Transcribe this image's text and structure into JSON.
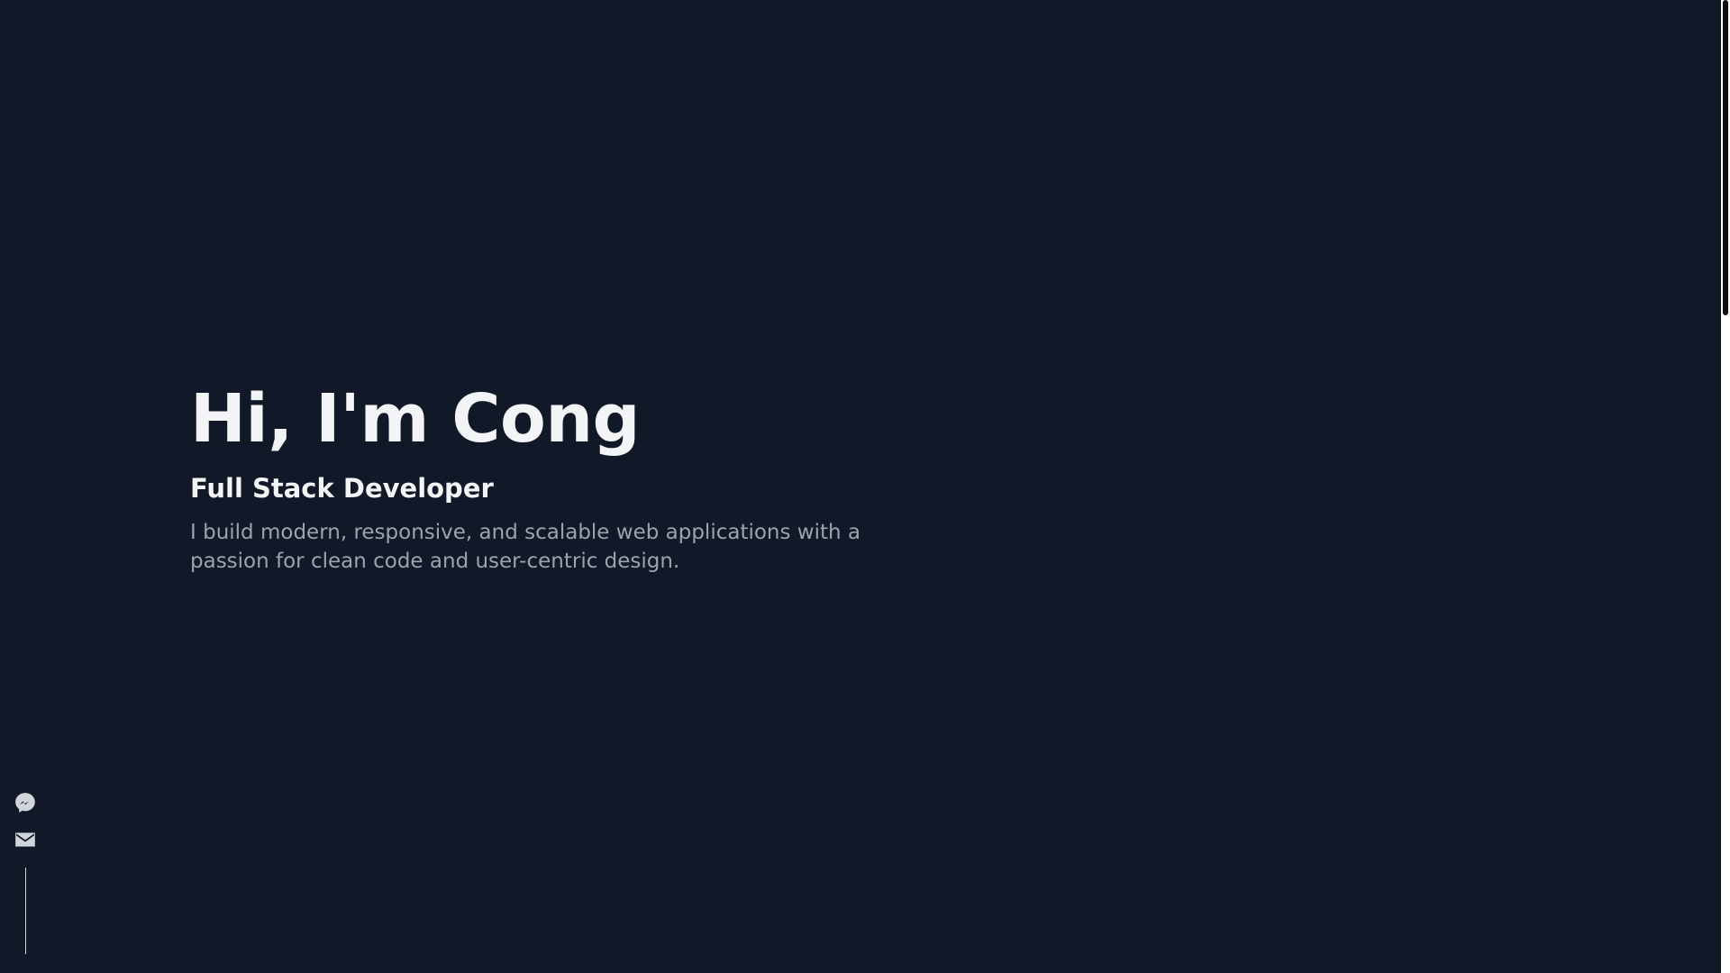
{
  "hero": {
    "title": "Hi, I'm Cong",
    "subtitle": "Full Stack Developer",
    "description": "I build modern, responsive, and scalable web applications with a passion for clean code and user-centric design."
  },
  "social": {
    "items": [
      {
        "icon": "messenger-icon"
      },
      {
        "icon": "mail-icon"
      }
    ]
  },
  "colors": {
    "background": "#111827",
    "heading": "#f3f4f6",
    "body_text": "#9ca3af",
    "icon": "#d1d5db"
  }
}
